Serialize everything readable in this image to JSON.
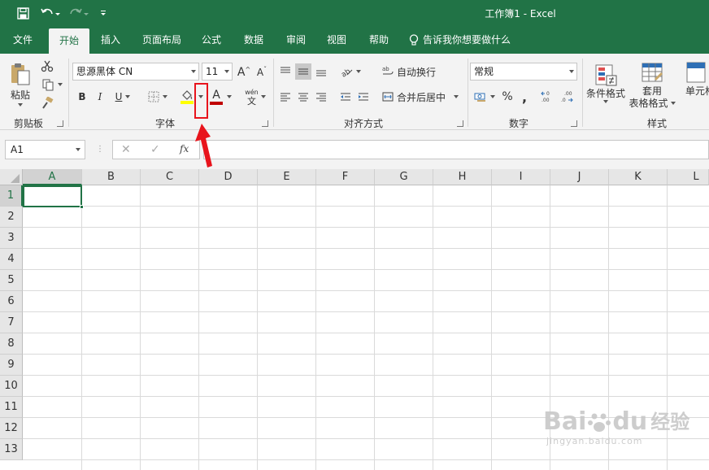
{
  "window": {
    "title": "工作簿1  -  Excel"
  },
  "tabs": [
    "文件",
    "开始",
    "插入",
    "页面布局",
    "公式",
    "数据",
    "审阅",
    "视图",
    "帮助"
  ],
  "tell_me": "告诉我你想要做什么",
  "groups": {
    "clipboard": {
      "label": "剪贴板",
      "paste": "粘贴"
    },
    "font": {
      "label": "字体",
      "font_name": "思源黑体 CN",
      "font_size": "11",
      "bold": "B",
      "italic": "I",
      "underline": "U",
      "grow": "A",
      "shrink": "A",
      "fill_color": "#ffff00",
      "font_color": "#c00000",
      "phonetic_top": "wén",
      "phonetic_bottom": "文"
    },
    "alignment": {
      "label": "对齐方式",
      "wrap": "自动换行",
      "merge": "合并后居中"
    },
    "number": {
      "label": "数字",
      "format": "常规",
      "percent": "%",
      "comma": ","
    },
    "styles": {
      "label": "样式",
      "conditional": "条件格式",
      "table_format_1": "套用",
      "table_format_2": "表格格式",
      "cell_styles": "单元格"
    }
  },
  "formula_bar": {
    "name_box": "A1",
    "cancel": "✕",
    "enter": "✓",
    "fx": "fx",
    "content": ""
  },
  "grid": {
    "columns": [
      "A",
      "B",
      "C",
      "D",
      "E",
      "F",
      "G",
      "H",
      "I",
      "J",
      "K",
      "L"
    ],
    "rows": [
      "1",
      "2",
      "3",
      "4",
      "5",
      "6",
      "7",
      "8",
      "9",
      "10",
      "11",
      "12",
      "13"
    ],
    "selected_cell": "A1"
  },
  "colors": {
    "accent": "#217346",
    "annotation": "#e8141c"
  },
  "watermark": {
    "line1": "Bai",
    "line2": "du",
    "line3": "经验",
    "url": "jingyan.baidu.com"
  }
}
